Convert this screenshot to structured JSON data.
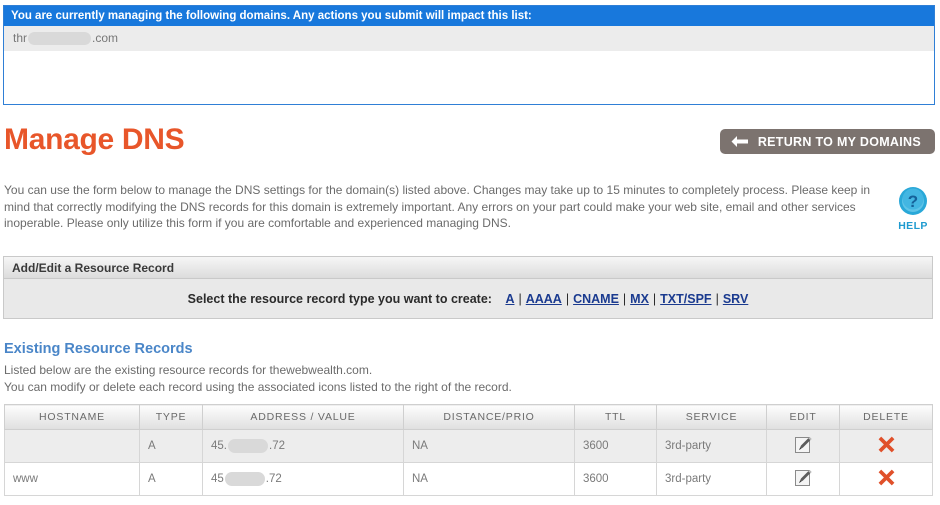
{
  "domain_panel": {
    "banner": "You are currently managing the following domains. Any actions you submit will impact this list:",
    "domain_prefix": "thr",
    "domain_suffix": ".com"
  },
  "header": {
    "page_title": "Manage DNS",
    "return_button": "RETURN TO MY DOMAINS",
    "return_icon": "arrow-left-icon"
  },
  "intro": {
    "paragraph": "You can use the form below to manage the DNS settings for the domain(s) listed above. Changes may take up to 15 minutes to completely process. Please keep in mind that correctly modifying the DNS records for this domain is extremely important. Any errors on your part could make your web site, email and other services inoperable. Please only utilize this form if you are comfortable and experienced managing DNS."
  },
  "help": {
    "icon": "question-mark-icon",
    "label": "HELP"
  },
  "add_edit": {
    "section_title": "Add/Edit a Resource Record",
    "select_label": "Select the resource record type you want to create:",
    "record_types": [
      "A",
      "AAAA",
      "CNAME",
      "MX",
      "TXT/SPF",
      "SRV"
    ],
    "separator": "|",
    "link_color": "#1a3a8f"
  },
  "existing": {
    "title": "Existing Resource Records",
    "desc_line1": "Listed below are the existing resource records for thewebwealth.com.",
    "desc_line2": "You can modify or delete each record using the associated icons listed to the right of the record.",
    "title_color": "#4a86c8"
  },
  "table": {
    "columns": [
      "HOSTNAME",
      "TYPE",
      "ADDRESS / VALUE",
      "DISTANCE/PRIO",
      "TTL",
      "SERVICE",
      "EDIT",
      "DELETE"
    ],
    "rows": [
      {
        "hostname": "",
        "type": "A",
        "address_prefix": "45.",
        "address_suffix": ".72",
        "distance": "NA",
        "ttl": "3600",
        "service": "3rd-party",
        "edit_icon": "edit-pencil-icon",
        "delete_icon": "delete-x-icon"
      },
      {
        "hostname": "www",
        "type": "A",
        "address_prefix": "45",
        "address_suffix": ".72",
        "distance": "NA",
        "ttl": "3600",
        "service": "3rd-party",
        "edit_icon": "edit-pencil-icon",
        "delete_icon": "delete-x-icon"
      }
    ]
  },
  "colors": {
    "banner_blue": "#1878dc",
    "title_orange": "#e8562a",
    "button_gray": "#7c736f",
    "delete_red": "#e0502a",
    "help_blue": "#1f9bd0"
  }
}
